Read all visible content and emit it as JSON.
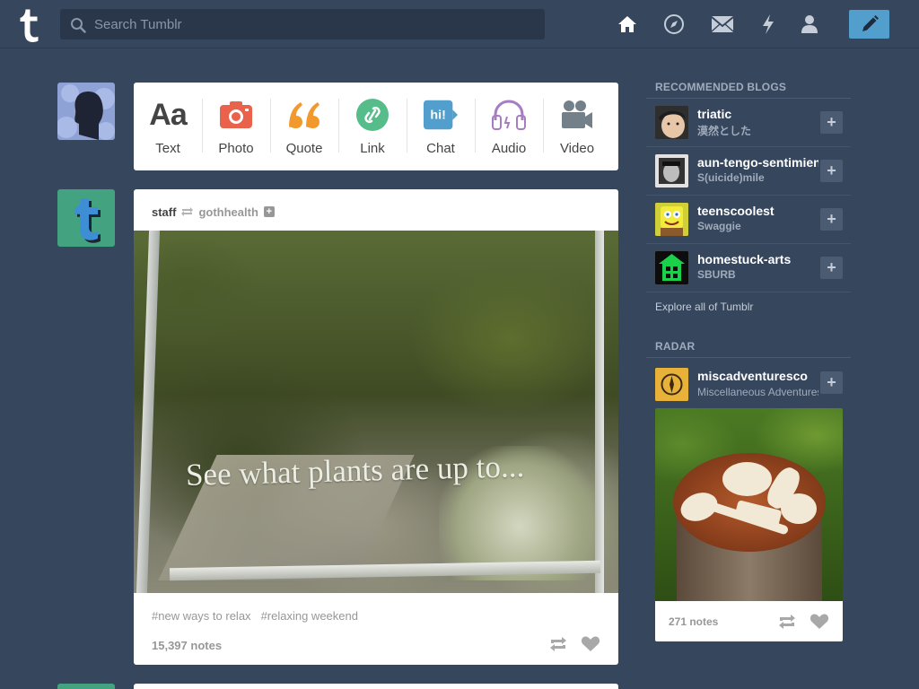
{
  "header": {
    "search_placeholder": "Search Tumblr"
  },
  "post_types": [
    {
      "label": "Text",
      "icon": "text-icon"
    },
    {
      "label": "Photo",
      "icon": "camera-icon"
    },
    {
      "label": "Quote",
      "icon": "quote-icon"
    },
    {
      "label": "Link",
      "icon": "link-icon"
    },
    {
      "label": "Chat",
      "icon": "chat-icon",
      "glyph": "hi!"
    },
    {
      "label": "Audio",
      "icon": "headphones-icon"
    },
    {
      "label": "Video",
      "icon": "video-camera-icon"
    }
  ],
  "post": {
    "author": "staff",
    "source": "gothhealth",
    "follow_glyph": "+",
    "photo_caption": "See what plants are up to...",
    "tags": [
      "#new ways to relax",
      "#relaxing weekend"
    ],
    "notes": "15,397 notes"
  },
  "sidebar": {
    "recommended_title": "RECOMMENDED BLOGS",
    "plus_glyph": "+",
    "blogs": [
      {
        "name": "triatic",
        "title": "漠然とした"
      },
      {
        "name": "aun-tengo-sentimientos",
        "title": "S(uicide)mile"
      },
      {
        "name": "teenscoolest",
        "title": "Swaggie"
      },
      {
        "name": "homestuck-arts",
        "title": "SBURB"
      }
    ],
    "explore": "Explore all of Tumblr",
    "radar_title": "RADAR",
    "radar": {
      "name": "miscadventuresco",
      "title": "Miscellaneous Adventures",
      "notes": "271 notes"
    }
  },
  "colors": {
    "background": "#36465d",
    "compose": "#529ecc",
    "photo_icon": "#e9634c",
    "quote_icon": "#f2992e",
    "link_icon": "#56bc8a",
    "chat_icon": "#529ecc",
    "audio_icon": "#a77dc2",
    "video_icon": "#748089"
  }
}
